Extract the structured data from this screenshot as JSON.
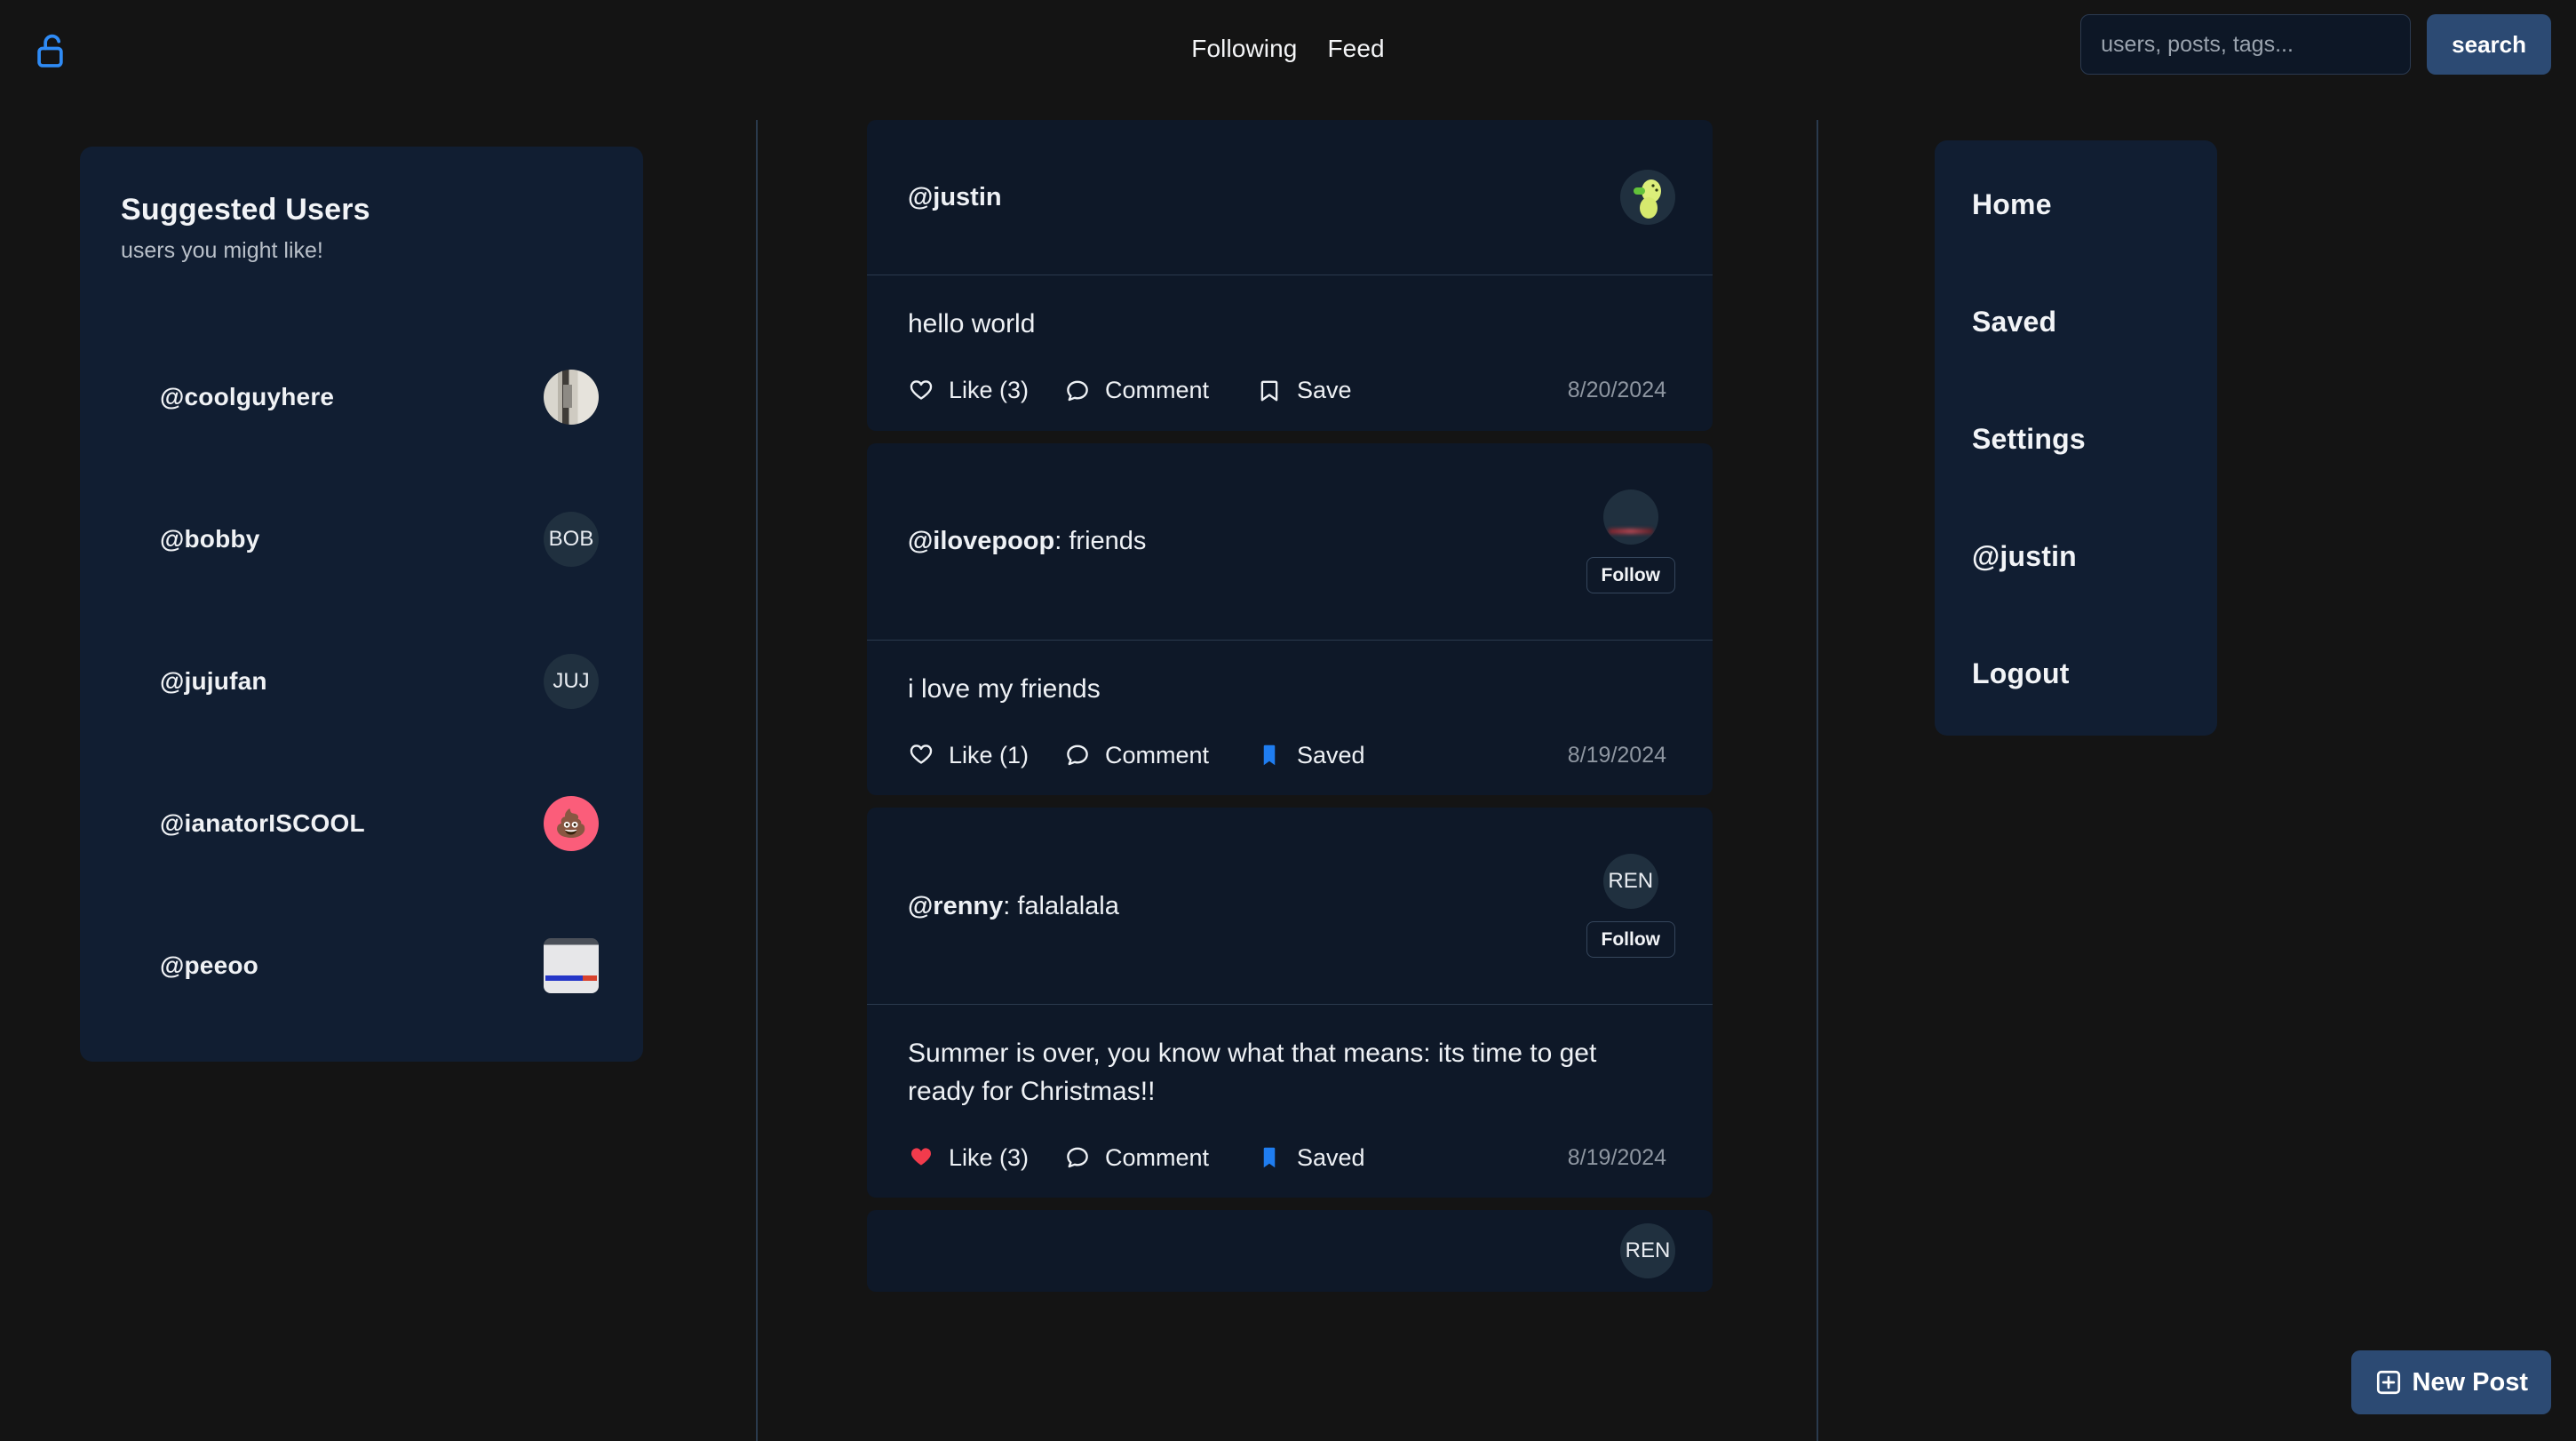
{
  "header": {
    "logo_icon": "unlock-icon",
    "logo_color": "#2f8bf5",
    "nav": [
      {
        "label": "Following"
      },
      {
        "label": "Feed"
      }
    ],
    "search": {
      "placeholder": "users, posts, tags...",
      "value": "",
      "button_label": "search"
    }
  },
  "suggested": {
    "title": "Suggested Users",
    "subtitle": "users you might like!",
    "users": [
      {
        "handle": "@coolguyhere",
        "avatar_kind": "photo",
        "avatar_style": "av-closet",
        "initials": ""
      },
      {
        "handle": "@bobby",
        "avatar_kind": "initials",
        "avatar_style": "",
        "initials": "BOB"
      },
      {
        "handle": "@jujufan",
        "avatar_kind": "initials",
        "avatar_style": "",
        "initials": "JUJ"
      },
      {
        "handle": "@ianatorISCOOL",
        "avatar_kind": "emoji",
        "avatar_style": "av-pink",
        "initials": "💩"
      },
      {
        "handle": "@peeoo",
        "avatar_kind": "photo",
        "avatar_style": "av-doc",
        "initials": ""
      }
    ]
  },
  "feed": {
    "posts": [
      {
        "author_handle": "@justin",
        "author_suffix": "",
        "avatar_kind": "photo",
        "avatar_style": "av-toy",
        "initials": "",
        "show_follow": false,
        "follow_label": "Follow",
        "text": "hello world",
        "like_label": "Like (3)",
        "liked": false,
        "comment_label": "Comment",
        "save_label": "Save",
        "saved": false,
        "date": "8/20/2024"
      },
      {
        "author_handle": "@ilovepoop",
        "author_suffix": ": friends",
        "avatar_kind": "photo",
        "avatar_style": "av-night",
        "initials": "",
        "show_follow": true,
        "follow_label": "Follow",
        "text": "i love my friends",
        "like_label": "Like (1)",
        "liked": false,
        "comment_label": "Comment",
        "save_label": "Saved",
        "saved": true,
        "date": "8/19/2024"
      },
      {
        "author_handle": "@renny",
        "author_suffix": ": falalalala",
        "avatar_kind": "initials",
        "avatar_style": "",
        "initials": "REN",
        "show_follow": true,
        "follow_label": "Follow",
        "text": "Summer is over, you know what that means: its time to get ready for Christmas!!",
        "like_label": "Like (3)",
        "liked": true,
        "comment_label": "Comment",
        "save_label": "Saved",
        "saved": true,
        "date": "8/19/2024"
      }
    ],
    "partial_post": {
      "initials": "REN"
    }
  },
  "right_menu": {
    "items": [
      {
        "label": "Home"
      },
      {
        "label": "Saved"
      },
      {
        "label": "Settings"
      },
      {
        "label": "@justin"
      },
      {
        "label": "Logout"
      }
    ]
  },
  "new_post": {
    "label": "New Post",
    "icon": "plus-square-icon"
  },
  "colors": {
    "page_background": "#141414",
    "card_background": "#0e1828",
    "panel_background": "#111e32",
    "accent_blue": "#2c4a73",
    "link_blue": "#2f8bf5",
    "saved_blue": "#1f7df0",
    "like_red": "#f13b4c",
    "muted_text": "#8e96a1",
    "divider": "#2a3a4d"
  }
}
